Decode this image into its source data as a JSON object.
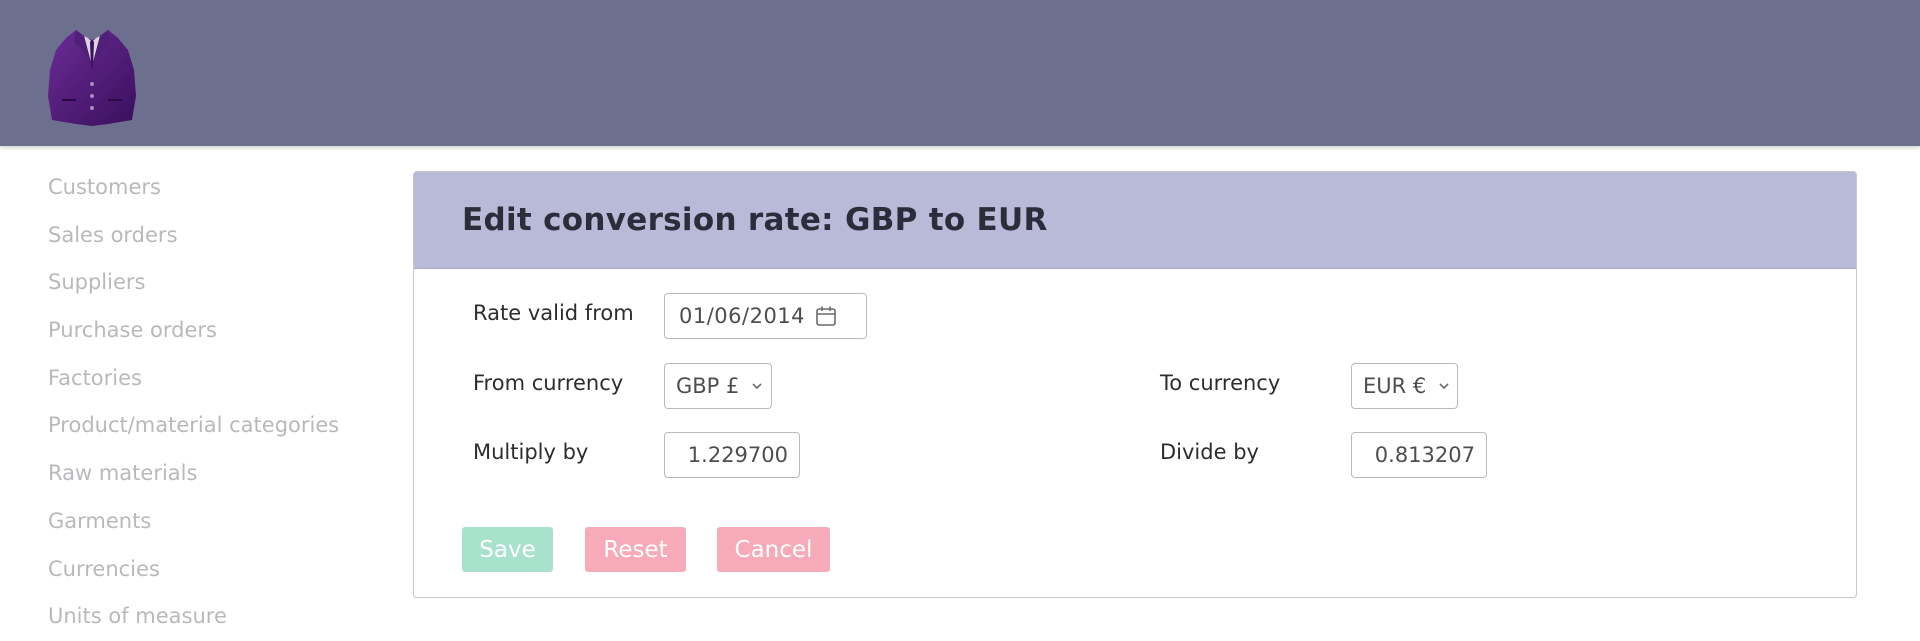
{
  "logo": {
    "icon": "suit-jacket-icon",
    "color": "#4a1b6e"
  },
  "colors": {
    "topbar": "#6c6f8e",
    "panel_header": "#b9b9d8",
    "save": "#a8e2cc",
    "danger": "#f7aab7"
  },
  "sidebar": {
    "items": [
      {
        "label": "Customers"
      },
      {
        "label": "Sales orders"
      },
      {
        "label": "Suppliers"
      },
      {
        "label": "Purchase orders"
      },
      {
        "label": "Factories"
      },
      {
        "label": "Product/material categories"
      },
      {
        "label": "Raw materials"
      },
      {
        "label": "Garments"
      },
      {
        "label": "Currencies"
      },
      {
        "label": "Units of measure"
      }
    ]
  },
  "panel": {
    "title": "Edit conversion rate: GBP to EUR"
  },
  "form": {
    "rate_valid_from": {
      "label": "Rate valid from",
      "value": "01/06/2014",
      "icon": "calendar-icon"
    },
    "from_currency": {
      "label": "From currency",
      "value": "GBP £"
    },
    "to_currency": {
      "label": "To currency",
      "value": "EUR €"
    },
    "multiply_by": {
      "label": "Multiply by",
      "value": "1.229700"
    },
    "divide_by": {
      "label": "Divide by",
      "value": "0.813207"
    }
  },
  "actions": {
    "save": "Save",
    "reset": "Reset",
    "cancel": "Cancel"
  }
}
